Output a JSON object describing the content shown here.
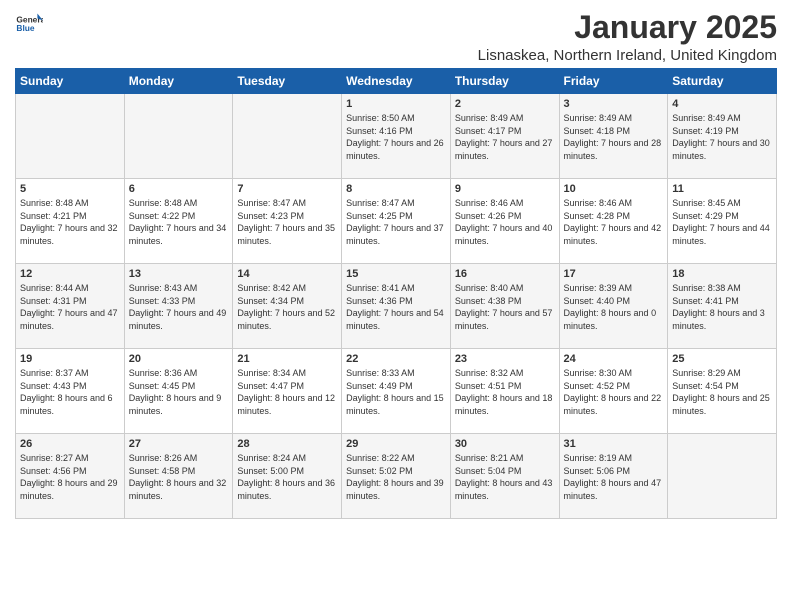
{
  "logo": {
    "general": "General",
    "blue": "Blue"
  },
  "title": "January 2025",
  "subtitle": "Lisnaskea, Northern Ireland, United Kingdom",
  "headers": [
    "Sunday",
    "Monday",
    "Tuesday",
    "Wednesday",
    "Thursday",
    "Friday",
    "Saturday"
  ],
  "weeks": [
    [
      {
        "day": "",
        "sunrise": "",
        "sunset": "",
        "daylight": ""
      },
      {
        "day": "",
        "sunrise": "",
        "sunset": "",
        "daylight": ""
      },
      {
        "day": "",
        "sunrise": "",
        "sunset": "",
        "daylight": ""
      },
      {
        "day": "1",
        "sunrise": "Sunrise: 8:50 AM",
        "sunset": "Sunset: 4:16 PM",
        "daylight": "Daylight: 7 hours and 26 minutes."
      },
      {
        "day": "2",
        "sunrise": "Sunrise: 8:49 AM",
        "sunset": "Sunset: 4:17 PM",
        "daylight": "Daylight: 7 hours and 27 minutes."
      },
      {
        "day": "3",
        "sunrise": "Sunrise: 8:49 AM",
        "sunset": "Sunset: 4:18 PM",
        "daylight": "Daylight: 7 hours and 28 minutes."
      },
      {
        "day": "4",
        "sunrise": "Sunrise: 8:49 AM",
        "sunset": "Sunset: 4:19 PM",
        "daylight": "Daylight: 7 hours and 30 minutes."
      }
    ],
    [
      {
        "day": "5",
        "sunrise": "Sunrise: 8:48 AM",
        "sunset": "Sunset: 4:21 PM",
        "daylight": "Daylight: 7 hours and 32 minutes."
      },
      {
        "day": "6",
        "sunrise": "Sunrise: 8:48 AM",
        "sunset": "Sunset: 4:22 PM",
        "daylight": "Daylight: 7 hours and 34 minutes."
      },
      {
        "day": "7",
        "sunrise": "Sunrise: 8:47 AM",
        "sunset": "Sunset: 4:23 PM",
        "daylight": "Daylight: 7 hours and 35 minutes."
      },
      {
        "day": "8",
        "sunrise": "Sunrise: 8:47 AM",
        "sunset": "Sunset: 4:25 PM",
        "daylight": "Daylight: 7 hours and 37 minutes."
      },
      {
        "day": "9",
        "sunrise": "Sunrise: 8:46 AM",
        "sunset": "Sunset: 4:26 PM",
        "daylight": "Daylight: 7 hours and 40 minutes."
      },
      {
        "day": "10",
        "sunrise": "Sunrise: 8:46 AM",
        "sunset": "Sunset: 4:28 PM",
        "daylight": "Daylight: 7 hours and 42 minutes."
      },
      {
        "day": "11",
        "sunrise": "Sunrise: 8:45 AM",
        "sunset": "Sunset: 4:29 PM",
        "daylight": "Daylight: 7 hours and 44 minutes."
      }
    ],
    [
      {
        "day": "12",
        "sunrise": "Sunrise: 8:44 AM",
        "sunset": "Sunset: 4:31 PM",
        "daylight": "Daylight: 7 hours and 47 minutes."
      },
      {
        "day": "13",
        "sunrise": "Sunrise: 8:43 AM",
        "sunset": "Sunset: 4:33 PM",
        "daylight": "Daylight: 7 hours and 49 minutes."
      },
      {
        "day": "14",
        "sunrise": "Sunrise: 8:42 AM",
        "sunset": "Sunset: 4:34 PM",
        "daylight": "Daylight: 7 hours and 52 minutes."
      },
      {
        "day": "15",
        "sunrise": "Sunrise: 8:41 AM",
        "sunset": "Sunset: 4:36 PM",
        "daylight": "Daylight: 7 hours and 54 minutes."
      },
      {
        "day": "16",
        "sunrise": "Sunrise: 8:40 AM",
        "sunset": "Sunset: 4:38 PM",
        "daylight": "Daylight: 7 hours and 57 minutes."
      },
      {
        "day": "17",
        "sunrise": "Sunrise: 8:39 AM",
        "sunset": "Sunset: 4:40 PM",
        "daylight": "Daylight: 8 hours and 0 minutes."
      },
      {
        "day": "18",
        "sunrise": "Sunrise: 8:38 AM",
        "sunset": "Sunset: 4:41 PM",
        "daylight": "Daylight: 8 hours and 3 minutes."
      }
    ],
    [
      {
        "day": "19",
        "sunrise": "Sunrise: 8:37 AM",
        "sunset": "Sunset: 4:43 PM",
        "daylight": "Daylight: 8 hours and 6 minutes."
      },
      {
        "day": "20",
        "sunrise": "Sunrise: 8:36 AM",
        "sunset": "Sunset: 4:45 PM",
        "daylight": "Daylight: 8 hours and 9 minutes."
      },
      {
        "day": "21",
        "sunrise": "Sunrise: 8:34 AM",
        "sunset": "Sunset: 4:47 PM",
        "daylight": "Daylight: 8 hours and 12 minutes."
      },
      {
        "day": "22",
        "sunrise": "Sunrise: 8:33 AM",
        "sunset": "Sunset: 4:49 PM",
        "daylight": "Daylight: 8 hours and 15 minutes."
      },
      {
        "day": "23",
        "sunrise": "Sunrise: 8:32 AM",
        "sunset": "Sunset: 4:51 PM",
        "daylight": "Daylight: 8 hours and 18 minutes."
      },
      {
        "day": "24",
        "sunrise": "Sunrise: 8:30 AM",
        "sunset": "Sunset: 4:52 PM",
        "daylight": "Daylight: 8 hours and 22 minutes."
      },
      {
        "day": "25",
        "sunrise": "Sunrise: 8:29 AM",
        "sunset": "Sunset: 4:54 PM",
        "daylight": "Daylight: 8 hours and 25 minutes."
      }
    ],
    [
      {
        "day": "26",
        "sunrise": "Sunrise: 8:27 AM",
        "sunset": "Sunset: 4:56 PM",
        "daylight": "Daylight: 8 hours and 29 minutes."
      },
      {
        "day": "27",
        "sunrise": "Sunrise: 8:26 AM",
        "sunset": "Sunset: 4:58 PM",
        "daylight": "Daylight: 8 hours and 32 minutes."
      },
      {
        "day": "28",
        "sunrise": "Sunrise: 8:24 AM",
        "sunset": "Sunset: 5:00 PM",
        "daylight": "Daylight: 8 hours and 36 minutes."
      },
      {
        "day": "29",
        "sunrise": "Sunrise: 8:22 AM",
        "sunset": "Sunset: 5:02 PM",
        "daylight": "Daylight: 8 hours and 39 minutes."
      },
      {
        "day": "30",
        "sunrise": "Sunrise: 8:21 AM",
        "sunset": "Sunset: 5:04 PM",
        "daylight": "Daylight: 8 hours and 43 minutes."
      },
      {
        "day": "31",
        "sunrise": "Sunrise: 8:19 AM",
        "sunset": "Sunset: 5:06 PM",
        "daylight": "Daylight: 8 hours and 47 minutes."
      },
      {
        "day": "",
        "sunrise": "",
        "sunset": "",
        "daylight": ""
      }
    ]
  ]
}
